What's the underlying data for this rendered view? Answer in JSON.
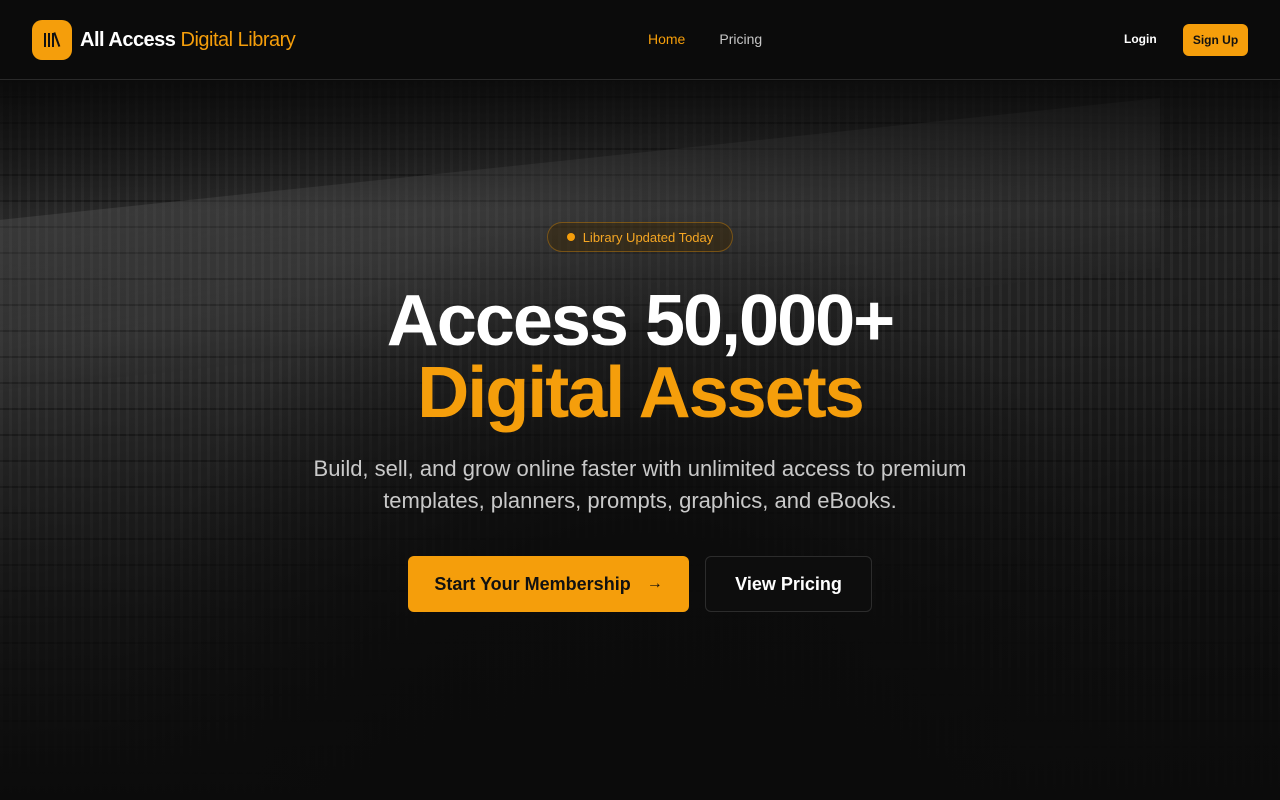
{
  "brand": {
    "icon": "library-books-icon",
    "name_primary": "All Access",
    "name_accent": "Digital Library",
    "accent_color": "#f59e0b"
  },
  "nav": {
    "items": [
      {
        "label": "Home",
        "active": true
      },
      {
        "label": "Pricing",
        "active": false
      }
    ]
  },
  "auth": {
    "login_label": "Login",
    "signup_label": "Sign Up"
  },
  "hero": {
    "badge_text": "Library Updated Today",
    "headline_line1": "Access 50,000+",
    "headline_line2": "Digital Assets",
    "subheadline": "Build, sell, and grow online faster with unlimited access to premium templates, planners, prompts, graphics, and eBooks.",
    "primary_cta": "Start Your Membership",
    "primary_cta_icon": "arrow-right-icon",
    "secondary_cta": "View Pricing"
  }
}
